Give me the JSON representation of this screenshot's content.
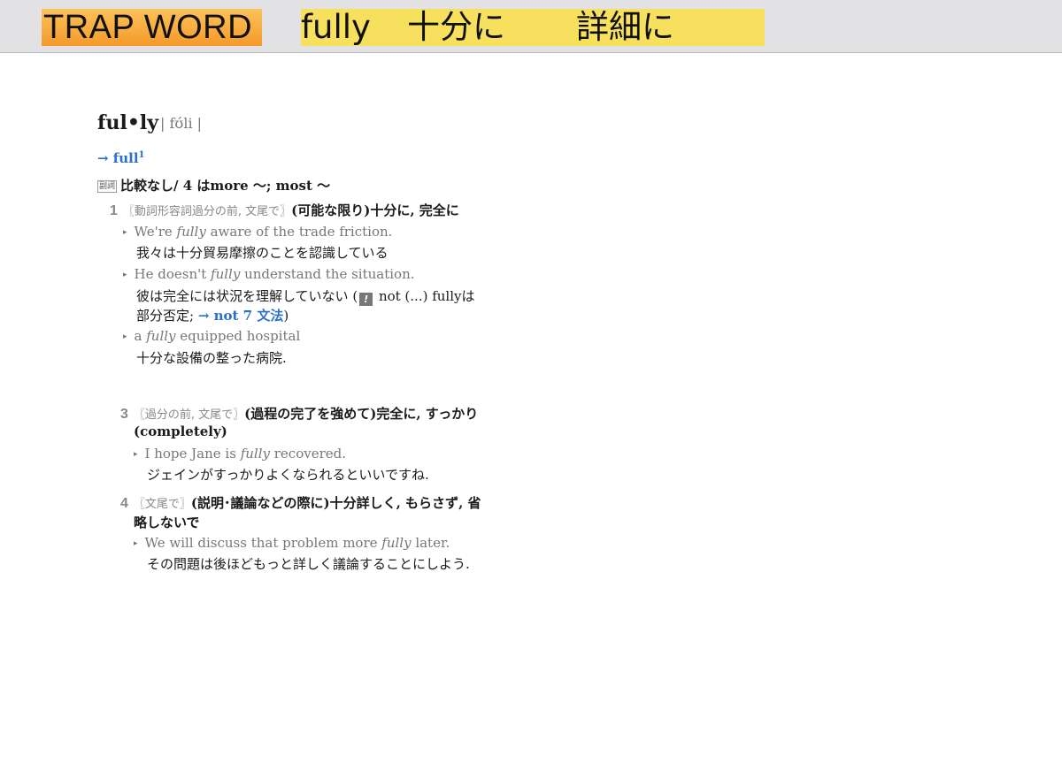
{
  "header": {
    "trap_label": "TRAP WORD",
    "word": "fully",
    "meaning_1": "十分に",
    "meaning_2": "詳細に"
  },
  "entry": {
    "headword": "ful•ly",
    "pronunciation": "| fʊ́li |",
    "xref": "→ full",
    "xref_sup": "1",
    "pos_badge": "副詞",
    "pos_text": "比較なし/ 4 はmore 〜; most 〜",
    "senses": [
      {
        "num": "1",
        "label": "〖動詞形容詞過分の前, 文尾で〗",
        "gloss": "(可能な限り)十分に, 完全に",
        "examples": [
          {
            "pre": "We're ",
            "em": "fully",
            "post": " aware of the trade friction.",
            "translation": "我々は十分貿易摩擦のことを認識している"
          },
          {
            "pre": "He doesn't ",
            "em": "fully",
            "post": " understand the situation.",
            "translation_1": "彼は完全には状況を理解していない (",
            "note_icon": "!",
            "translation_2": " not (...) fullyは",
            "translation_3": "部分否定; ",
            "link": "→ not 7 文法",
            "translation_4": ")"
          },
          {
            "pre": "a ",
            "em": "fully",
            "post": " equipped hospital",
            "translation": "十分な設備の整った病院."
          }
        ]
      },
      {
        "num": "3",
        "label": "〖過分の前, 文尾で〗",
        "gloss": "(過程の完了を強めて)完全に, すっかり",
        "gloss_2": "(completely)",
        "examples": [
          {
            "pre": "I hope Jane is ",
            "em": "fully",
            "post": " recovered.",
            "translation": "ジェインがすっかりよくなられるといいですね."
          }
        ]
      },
      {
        "num": "4",
        "label": "〖文尾で〗",
        "gloss": "(説明･議論などの際に)十分詳しく, もらさず, 省",
        "gloss_2": "略しないで",
        "examples": [
          {
            "pre": "We will discuss that problem more ",
            "em": "fully",
            "post": " later.",
            "translation": "その問題は後ほどもっと詳しく議論することにしよう."
          }
        ]
      }
    ]
  }
}
